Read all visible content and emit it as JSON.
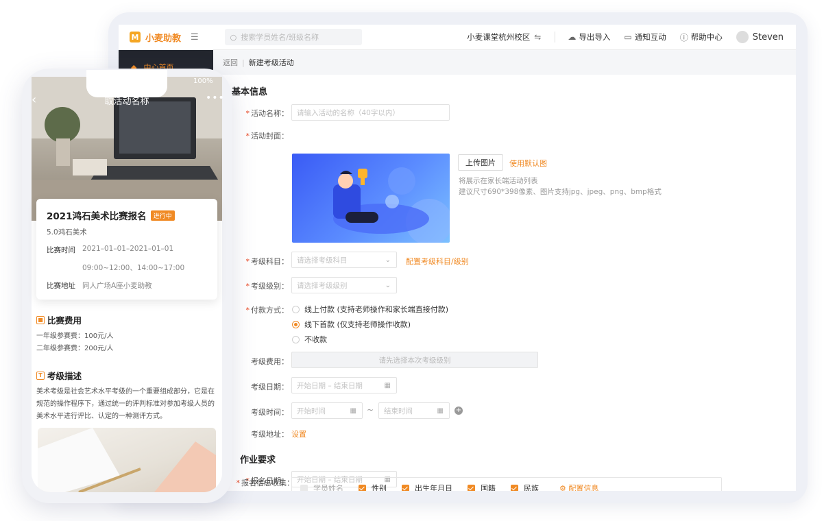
{
  "desktop": {
    "topbar": {
      "logo_mark": "M",
      "brand": "小麦助教",
      "search_placeholder": "搜索学员姓名/班级名称",
      "campus": "小麦课堂杭州校区",
      "export_import": "导出导入",
      "notify": "通知互动",
      "help": "帮助中心",
      "user": "Steven"
    },
    "sidebar": {
      "home": "中心首页"
    },
    "breadcrumb": {
      "back": "返回",
      "current": "新建考级活动"
    },
    "basic": {
      "section_title": "基本信息",
      "name_label": "活动名称：",
      "name_placeholder": "请输入活动的名称（40字以内）",
      "cover_label": "活动封面：",
      "upload_btn": "上传图片",
      "default_link": "使用默认图",
      "hint1": "将展示在家长端活动列表",
      "hint2": "建议尺寸690*398像素、图片支持jpg、jpeg、png、bmp格式",
      "subject_label": "考级科目：",
      "subject_placeholder": "请选择考级科目",
      "subject_config_link": "配置考级科目/级别",
      "level_label": "考级级别：",
      "level_placeholder": "请选择考级级别",
      "pay_label": "付款方式：",
      "pay_options": [
        {
          "label": "线上付款 (支持老师操作和家长端直接付款)",
          "selected": false
        },
        {
          "label": "线下首款 (仅支持老师操作收款)",
          "selected": true
        },
        {
          "label": "不收款",
          "selected": false
        }
      ],
      "fee_label": "考级费用：",
      "fee_placeholder": "请先选择本次考级级别",
      "date_label": "考级日期：",
      "date_placeholder": "开始日期 – 结束日期",
      "time_label": "考级时间：",
      "time_start": "开始时间",
      "time_end": "结束时间",
      "tilde": "~",
      "addr_label": "考级地址：",
      "addr_link": "设置"
    },
    "homework": {
      "section_title": "作业要求",
      "signup_label": "报名日期：",
      "signup_placeholder": "开始日期 – 结束日期",
      "collect_label": "报名信息收集：",
      "fields": [
        {
          "label": "学员姓名",
          "checked": false
        },
        {
          "label": "性别",
          "checked": true
        },
        {
          "label": "出生年月日",
          "checked": true
        },
        {
          "label": "国籍",
          "checked": true
        },
        {
          "label": "民族",
          "checked": true
        }
      ],
      "config_link": "配置信息"
    }
  },
  "phone": {
    "status_battery": "100%",
    "nav_title": "取活动名称",
    "event_title": "2021鸿石美术比赛报名",
    "event_badge": "进行中",
    "event_org": "5.0鸿石美术",
    "time_key": "比赛时间",
    "time_val1": "2021–01–01–2021–01–01",
    "time_val2": "09:00~12:00、14:00~17:00",
    "addr_key": "比赛地址",
    "addr_val": "同人广场A座小麦助教",
    "fee_title": "比赛费用",
    "fee_line1": "一年级参赛费：100元/人",
    "fee_line2": "二年级参赛费：200元/人",
    "desc_title": "考级描述",
    "desc_line1": "美术考级是社会艺术水平考级的一个重要组成部分，它是在",
    "desc_line2": "规范的操作程序下，通过统一的评判标准对参加考级人员的",
    "desc_line3": "美术水平进行评比、认定的一种测评方式。"
  },
  "colors": {
    "accent": "#f08a24",
    "required": "#e8431f",
    "sidebar": "#23262e"
  }
}
